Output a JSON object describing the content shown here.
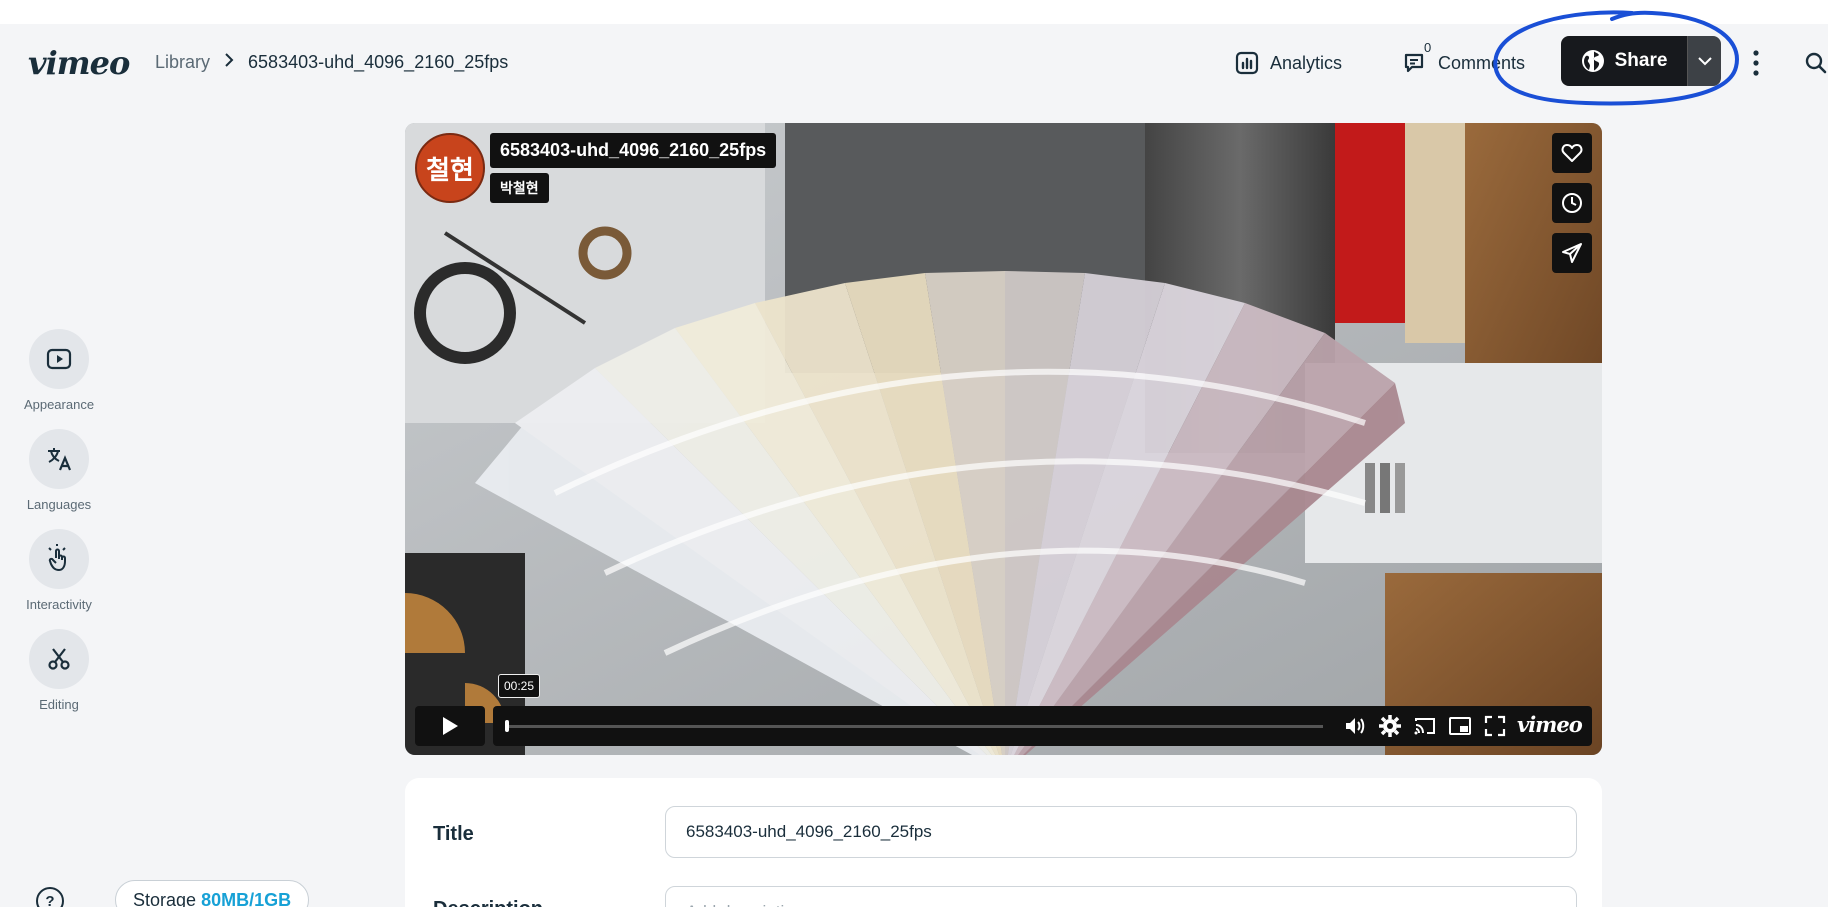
{
  "header": {
    "logo": "vimeo",
    "breadcrumb": {
      "parent": "Library",
      "current": "6583403-uhd_4096_2160_25fps"
    },
    "analytics_label": "Analytics",
    "comments_label": "Comments",
    "comments_count": "0",
    "share_label": "Share",
    "icons": [
      "analytics-icon",
      "comments-icon",
      "globe-icon",
      "chevron-down-icon",
      "more-icon",
      "search-icon"
    ]
  },
  "sidebar": {
    "items": [
      {
        "label": "Appearance",
        "icon": "play-square-icon"
      },
      {
        "label": "Languages",
        "icon": "translate-icon"
      },
      {
        "label": "Interactivity",
        "icon": "tap-icon"
      },
      {
        "label": "Editing",
        "icon": "scissors-icon"
      }
    ]
  },
  "player": {
    "avatar_text": "철현",
    "title": "6583403-uhd_4096_2160_25fps",
    "owner": "박철현",
    "time_tooltip": "00:25",
    "progress": 0.0,
    "logo": "vimeo",
    "side_controls": [
      "heart-icon",
      "clock-icon",
      "send-icon"
    ],
    "controls": [
      "play-icon",
      "volume-icon",
      "settings-icon",
      "cast-icon",
      "pip-icon",
      "fullscreen-icon"
    ]
  },
  "details": {
    "title_label": "Title",
    "title_value": "6583403-uhd_4096_2160_25fps",
    "description_label": "Description",
    "description_placeholder": "Add description"
  },
  "footer": {
    "help": "?",
    "storage_label": "Storage",
    "storage_amount": "80MB/1GB"
  },
  "colors": {
    "accent": "#17a1d6",
    "share_bg": "#17191d",
    "annotation": "#1a4fd6",
    "avatar_bg": "#c8441c"
  }
}
